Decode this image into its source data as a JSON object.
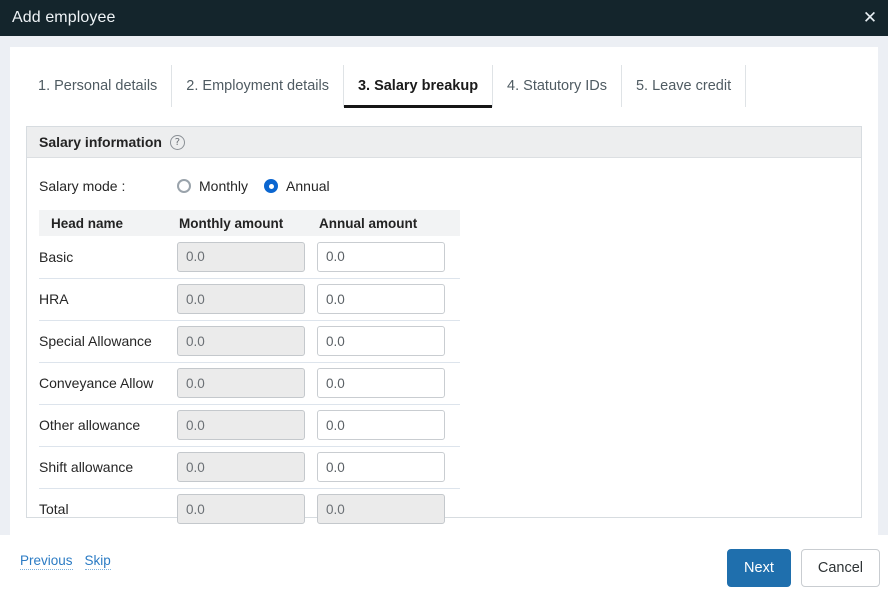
{
  "window": {
    "title": "Add employee",
    "close_icon": "close-icon",
    "close_glyph": "✕"
  },
  "tabs": [
    {
      "label": "1. Personal details",
      "active": false
    },
    {
      "label": "2. Employment details",
      "active": false
    },
    {
      "label": "3. Salary breakup",
      "active": true
    },
    {
      "label": "4. Statutory IDs",
      "active": false
    },
    {
      "label": "5. Leave credit",
      "active": false
    }
  ],
  "panel": {
    "title": "Salary information",
    "help_icon": "help-icon",
    "help_glyph": "?"
  },
  "salary_mode": {
    "label": "Salary mode :",
    "options": [
      {
        "label": "Monthly",
        "selected": false
      },
      {
        "label": "Annual",
        "selected": true
      }
    ]
  },
  "table": {
    "headers": [
      "Head name",
      "Monthly amount",
      "Annual amount"
    ],
    "rows": [
      {
        "head": "Basic",
        "monthly": "0.0",
        "annual": "0.0",
        "monthly_disabled": true,
        "annual_disabled": false
      },
      {
        "head": "HRA",
        "monthly": "0.0",
        "annual": "0.0",
        "monthly_disabled": true,
        "annual_disabled": false
      },
      {
        "head": "Special Allowance",
        "monthly": "0.0",
        "annual": "0.0",
        "monthly_disabled": true,
        "annual_disabled": false
      },
      {
        "head": "Conveyance Allow",
        "monthly": "0.0",
        "annual": "0.0",
        "monthly_disabled": true,
        "annual_disabled": false
      },
      {
        "head": "Other allowance",
        "monthly": "0.0",
        "annual": "0.0",
        "monthly_disabled": true,
        "annual_disabled": false
      },
      {
        "head": "Shift allowance",
        "monthly": "0.0",
        "annual": "0.0",
        "monthly_disabled": true,
        "annual_disabled": false
      },
      {
        "head": "Total",
        "monthly": "0.0",
        "annual": "0.0",
        "monthly_disabled": true,
        "annual_disabled": true
      }
    ]
  },
  "footer": {
    "previous_label": "Previous",
    "skip_label": "Skip",
    "next_label": "Next",
    "cancel_label": "Cancel"
  },
  "colors": {
    "titlebar_bg": "#14252c",
    "page_bg": "#eceff4",
    "accent_primary": "#1f6fad",
    "radio_selected": "#0b66d0",
    "link": "#2b7bc4"
  }
}
